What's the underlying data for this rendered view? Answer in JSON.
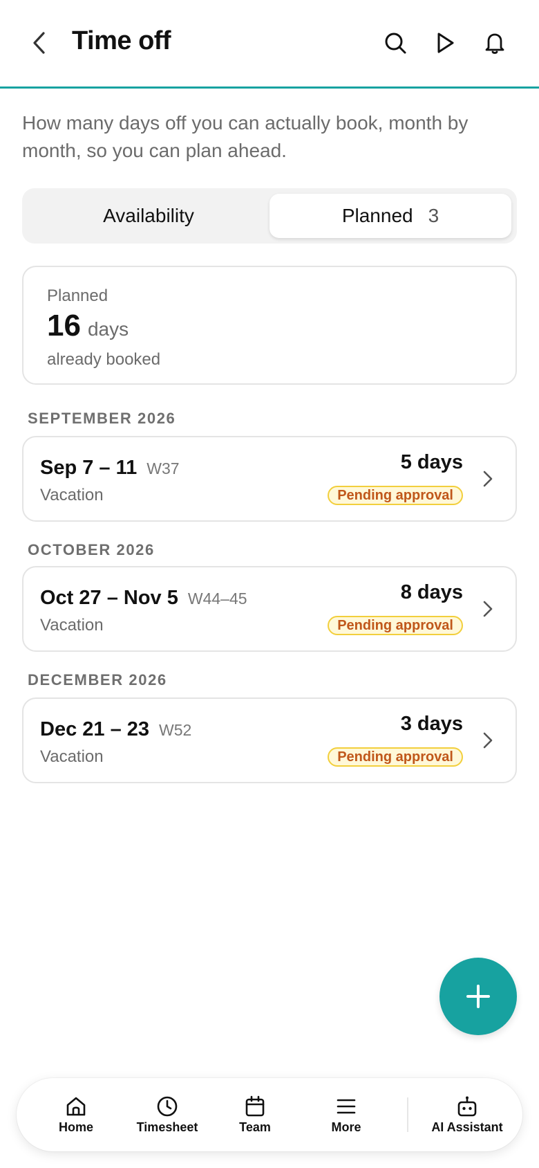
{
  "header": {
    "title": "Time off",
    "back_icon": "chevron-left-icon",
    "actions": [
      "search-icon",
      "play-icon",
      "bell-icon"
    ],
    "accent_color": "#17a2a0"
  },
  "intro": "How many days off you can actually book, month by month, so you can plan ahead.",
  "tabs": {
    "availability": "Availability",
    "planned": "Planned",
    "planned_count": "3",
    "active": "Planned"
  },
  "summary": {
    "label": "Planned",
    "value": "16",
    "unit": "days",
    "sub": "already booked"
  },
  "sections": [
    {
      "heading": "SEPTEMBER 2026",
      "entries": [
        {
          "range": "Sep 7 – 11",
          "week": "W37",
          "type": "Vacation",
          "days": "5 days",
          "status": "Pending approval"
        }
      ]
    },
    {
      "heading": "OCTOBER 2026",
      "entries": [
        {
          "range": "Oct 27 – Nov 5",
          "week": "W44–45",
          "type": "Vacation",
          "days": "8 days",
          "status": "Pending approval"
        }
      ]
    },
    {
      "heading": "DECEMBER 2026",
      "entries": [
        {
          "range": "Dec 21 – 23",
          "week": "W52",
          "type": "Vacation",
          "days": "3 days",
          "status": "Pending approval"
        }
      ]
    }
  ],
  "status_colors": {
    "pending_text": "#c0571a",
    "pending_border": "#f2cf3c",
    "pending_bg": "#fff8d8"
  },
  "fab": {
    "icon": "plus-icon"
  },
  "bottom_nav": {
    "home": "Home",
    "timesheet": "Timesheet",
    "team": "Team",
    "more": "More",
    "assistant": "AI Assistant"
  }
}
